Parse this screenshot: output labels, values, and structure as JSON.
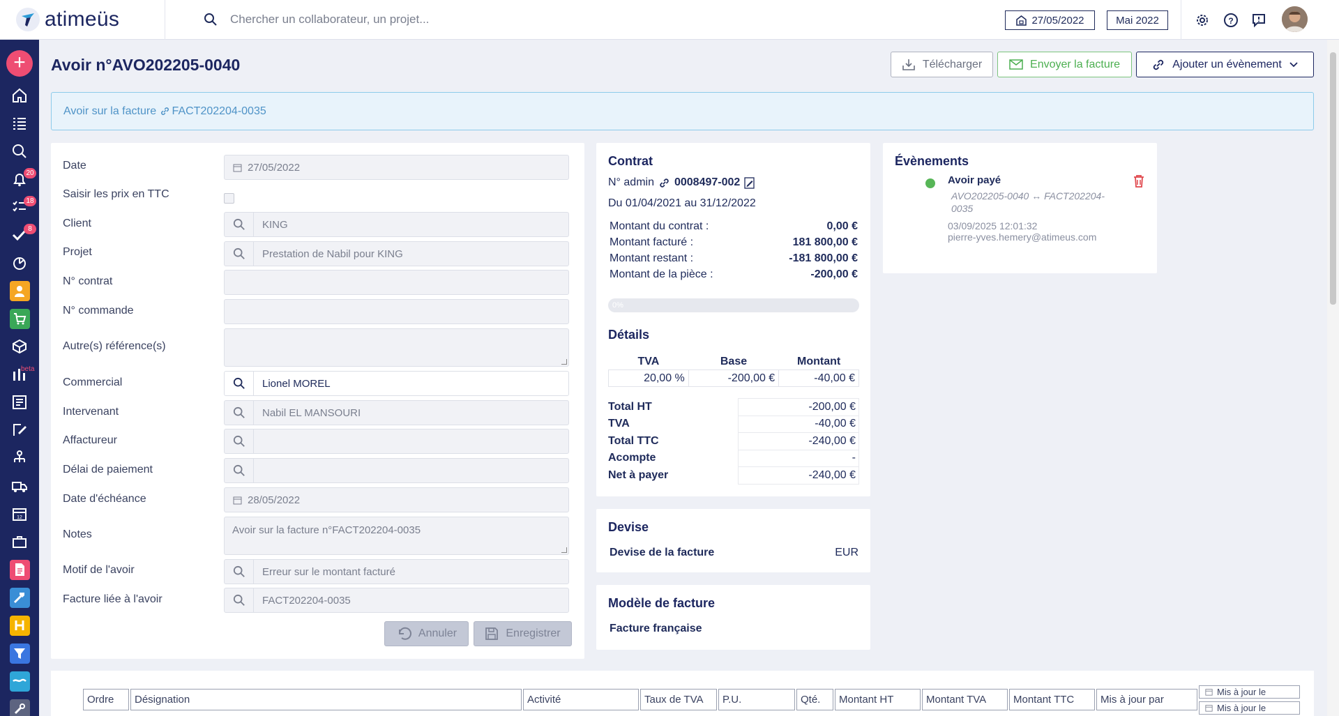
{
  "app": {
    "name": "atimeüs"
  },
  "search": {
    "placeholder": "Chercher un collaborateur, un projet..."
  },
  "header": {
    "date": "27/05/2022",
    "month": "Mai 2022"
  },
  "sidebar": {
    "badges": {
      "notifications": "20",
      "tasks": "18",
      "validations": "8"
    },
    "beta_label": "beta"
  },
  "page": {
    "title": "Avoir n°AVO202205-0040"
  },
  "actions": {
    "download": "Télécharger",
    "send": "Envoyer la facture",
    "add_event": "Ajouter un évènement"
  },
  "alert": {
    "prefix": "Avoir sur la facture ",
    "link": "FACT202204-0035"
  },
  "form": {
    "date_label": "Date",
    "date_value": "27/05/2022",
    "ttc_label": "Saisir les prix en TTC",
    "client_label": "Client",
    "client_value": "KING",
    "project_label": "Projet",
    "project_value": "Prestation de Nabil pour KING",
    "contract_label": "N° contrat",
    "contract_value": "",
    "order_label": "N° commande",
    "order_value": "",
    "other_ref_label": "Autre(s) référence(s)",
    "other_ref_value": "",
    "sales_label": "Commercial",
    "sales_value": "Lionel MOREL",
    "consultant_label": "Intervenant",
    "consultant_value": "Nabil EL MANSOURI",
    "factor_label": "Affactureur",
    "factor_value": "",
    "payment_label": "Délai de paiement",
    "payment_value": "",
    "due_label": "Date d'échéance",
    "due_value": "28/05/2022",
    "notes_label": "Notes",
    "notes_value": "Avoir sur la facture n°FACT202204-0035",
    "reason_label": "Motif de l'avoir",
    "reason_value": "Erreur sur le montant facturé",
    "linked_label": "Facture liée à l'avoir",
    "linked_value": "FACT202204-0035",
    "cancel": "Annuler",
    "save": "Enregistrer"
  },
  "contract": {
    "title": "Contrat",
    "admin_prefix": "N° admin",
    "admin_no": "0008497-002",
    "period": "Du 01/04/2021 au 31/12/2022",
    "rows": [
      {
        "label": "Montant du contrat :",
        "value": "0,00 €"
      },
      {
        "label": "Montant facturé :",
        "value": "181 800,00 €"
      },
      {
        "label": "Montant restant :",
        "value": "-181 800,00 €"
      },
      {
        "label": "Montant de la pièce :",
        "value": "-200,00 €"
      }
    ],
    "progress_label": "0%",
    "progress_value": 0
  },
  "details": {
    "title": "Détails",
    "headers": [
      "TVA",
      "Base",
      "Montant"
    ],
    "vat_row": [
      "20,00 %",
      "-200,00 €",
      "-40,00 €"
    ],
    "totals": [
      {
        "label": "Total HT",
        "value": "-200,00 €"
      },
      {
        "label": "TVA",
        "value": "-40,00 €"
      },
      {
        "label": "Total TTC",
        "value": "-240,00 €"
      },
      {
        "label": "Acompte",
        "value": "-"
      },
      {
        "label": "Net à payer",
        "value": "-240,00 €"
      }
    ]
  },
  "currency": {
    "title": "Devise",
    "label": "Devise de la facture",
    "value": "EUR"
  },
  "template": {
    "title": "Modèle de facture",
    "value": "Facture française"
  },
  "events": {
    "title": "Évènements",
    "item": {
      "title": "Avoir payé",
      "ref": "AVO202205-0040 ↔ FACT202204-0035",
      "datetime": "03/09/2025 12:01:32",
      "user": "pierre-yves.hemery@atimeus.com"
    }
  },
  "lines_table": {
    "headers": [
      "Ordre",
      "Désignation",
      "Activité",
      "Taux de TVA",
      "P.U.",
      "Qté.",
      "Montant HT",
      "Montant TVA",
      "Montant TTC",
      "Mis à jour par"
    ],
    "updated_on": "Mis à jour le"
  },
  "colors": {
    "navy": "#1c2660",
    "accent_pink": "#ee4d73",
    "green": "#57b657",
    "link_blue": "#4f93c7"
  }
}
